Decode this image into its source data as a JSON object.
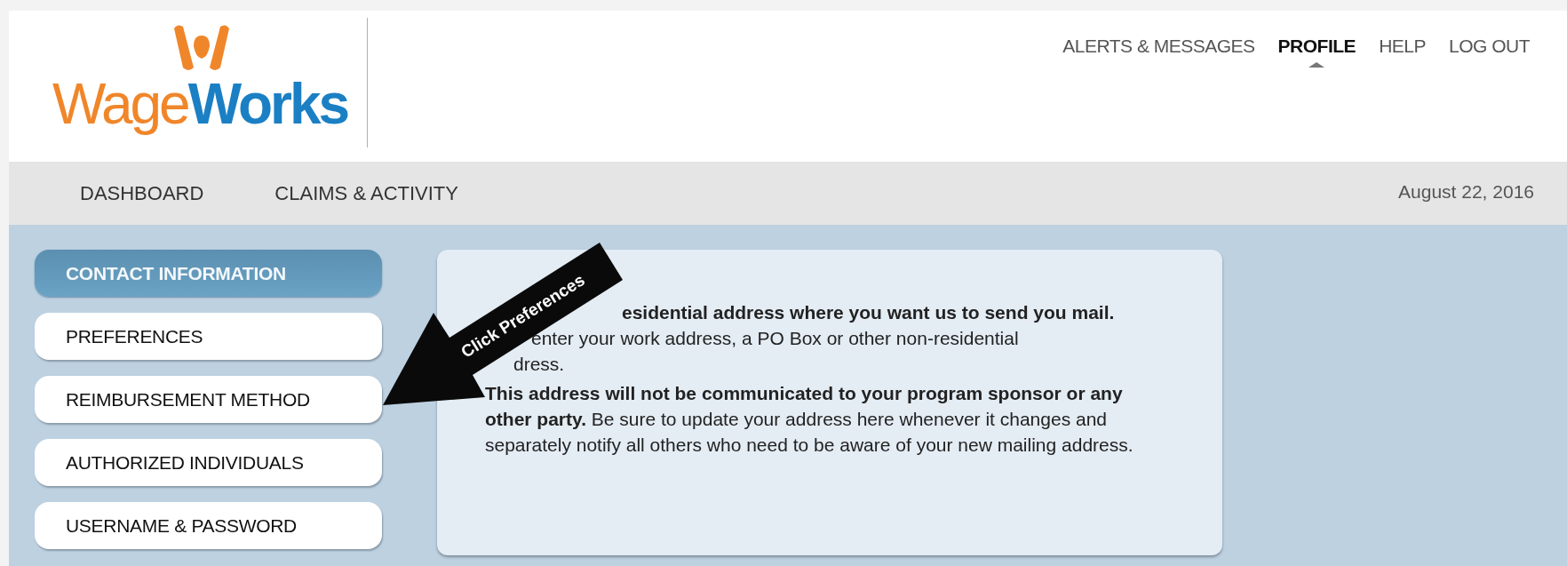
{
  "logo": {
    "text": "Wage**Works**"
  },
  "top_nav": [
    {
      "label": "ALERTS & MESSAGES",
      "selected": false
    },
    {
      "label": "PROFILE",
      "selected": true
    },
    {
      "label": "HELP",
      "selected": false
    },
    {
      "label": "LOG OUT",
      "selected": false
    }
  ],
  "main_nav": [
    {
      "label": "DASHBOARD"
    },
    {
      "label": "CLAIMS & ACTIVITY"
    }
  ],
  "date": "August 22, 2016",
  "sidebar": {
    "items": [
      {
        "label": "CONTACT INFORMATION",
        "selected": true
      },
      {
        "label": "PREFERENCES",
        "selected": false
      },
      {
        "label": "REIMBURSEMENT METHOD",
        "selected": false
      },
      {
        "label": "AUTHORIZED INDIVIDUALS",
        "selected": false
      },
      {
        "label": "USERNAME & PASSWORD",
        "selected": false
      }
    ]
  },
  "info_card": {
    "covered_lines": [
      "**esidential address where you want us to send you mail.**",
      "enter your work address, a PO Box or other non-residential",
      "dress."
    ],
    "paragraph": "**This address will not be communicated to your program sponsor or any other party.** Be sure to update your address here whenever it changes and separately notify all others who need to be aware of your new mailing address."
  },
  "callout": {
    "label": "Click Preferences"
  }
}
